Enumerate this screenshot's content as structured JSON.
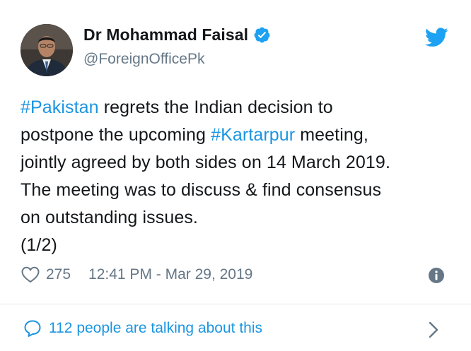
{
  "tweet": {
    "author_name": "Dr Mohammad Faisal",
    "handle": "@ForeignOfficePk",
    "text_lines": [
      {
        "parts": [
          {
            "text": "#Pakistan",
            "hashtag": true
          },
          {
            "text": " regrets the Indian decision to",
            "hashtag": false
          }
        ]
      },
      {
        "parts": [
          {
            "text": "postpone the upcoming ",
            "hashtag": false
          },
          {
            "text": "#Kartarpur",
            "hashtag": true
          },
          {
            "text": " meeting,",
            "hashtag": false
          }
        ]
      },
      {
        "parts": [
          {
            "text": "jointly agreed by both sides on 14 March 2019.",
            "hashtag": false
          }
        ]
      },
      {
        "parts": [
          {
            "text": "The meeting was to discuss & find consensus",
            "hashtag": false
          }
        ]
      },
      {
        "parts": [
          {
            "text": "on outstanding issues.",
            "hashtag": false
          }
        ]
      },
      {
        "parts": [
          {
            "text": "(1/2)",
            "hashtag": false
          }
        ]
      }
    ],
    "likes": "275",
    "timestamp": "12:41 PM - Mar 29, 2019",
    "talking_about": "112 people are talking about this"
  },
  "colors": {
    "accent": "#1b95e0",
    "twitter_blue": "#1da1f2",
    "muted": "#657786",
    "text": "#14171a",
    "divider": "#e1e8ed"
  },
  "icons": {
    "verified": "verified-badge-icon",
    "bird": "twitter-bird-icon",
    "like": "heart-icon",
    "info": "info-icon",
    "replies": "speech-bubble-icon",
    "more": "chevron-right-icon"
  }
}
